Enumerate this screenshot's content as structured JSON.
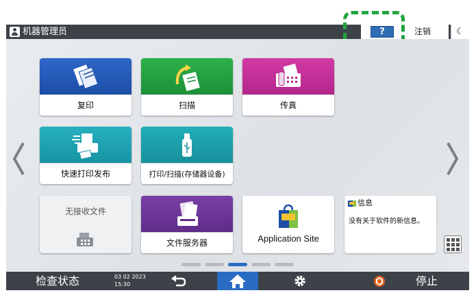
{
  "header": {
    "user_label": "机器管理员",
    "help_label": "?",
    "logout_label": "注销",
    "sleep_label": "☾"
  },
  "tiles": {
    "copy": "复印",
    "scan": "扫描",
    "fax": "传真",
    "quick_print": "快速打印发布",
    "print_scan_storage": "打印/扫描(存储器设备)",
    "no_received_files": "无接收文件",
    "document_server": "文件服务器",
    "application_site": "Application Site"
  },
  "info_widget": {
    "title": "信息",
    "body": "没有关于软件的新信息。"
  },
  "pager": {
    "pages": 5,
    "active_page": 3
  },
  "footer": {
    "status_label": "检查状态",
    "date": "03 02 2023",
    "time": "15:30",
    "stop_label": "停止"
  },
  "colors": {
    "accent": "#2a6cc4",
    "bar": "#3d4249",
    "highlight": "#22a43f"
  }
}
